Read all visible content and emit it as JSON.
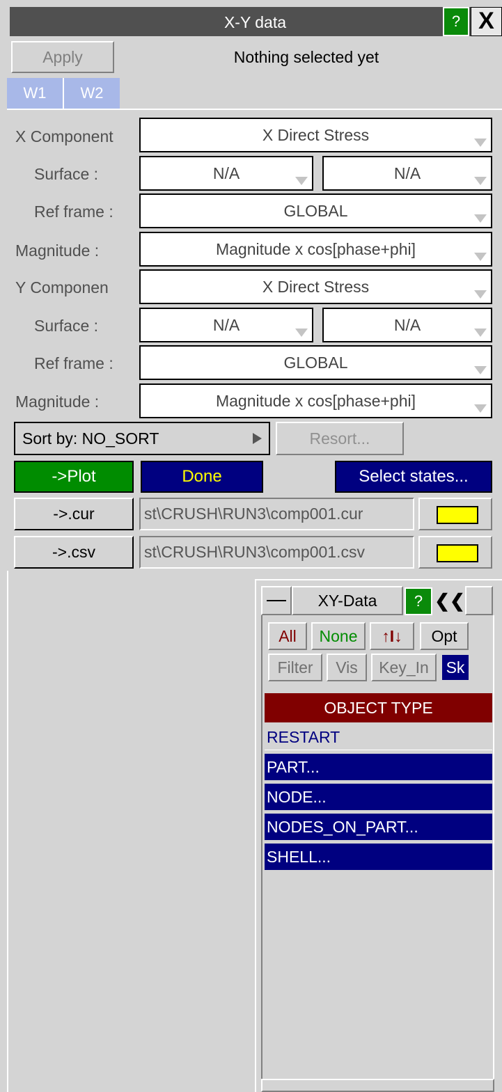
{
  "window": {
    "title": "X-Y data",
    "help": "?",
    "close": "X"
  },
  "toolbar": {
    "apply_label": "Apply",
    "status": "Nothing selected yet"
  },
  "tabs": [
    "W1",
    "W2"
  ],
  "x_component": {
    "label": "X Component",
    "value": "X Direct Stress",
    "surface_label": "Surface :",
    "surface_1": "N/A",
    "surface_2": "N/A",
    "ref_frame_label": "Ref frame :",
    "ref_frame": "GLOBAL",
    "magnitude_label": "Magnitude :",
    "magnitude": "Magnitude x cos[phase+phi]"
  },
  "y_component": {
    "label": "Y Componen",
    "value": "X Direct Stress",
    "surface_label": "Surface :",
    "surface_1": "N/A",
    "surface_2": "N/A",
    "ref_frame_label": "Ref frame :",
    "ref_frame": "GLOBAL",
    "magnitude_label": "Magnitude :",
    "magnitude": "Magnitude x cos[phase+phi]"
  },
  "sort": {
    "label": "Sort by: NO_SORT",
    "resort_label": "Resort..."
  },
  "actions": {
    "plot_label": "->Plot",
    "done_label": "Done",
    "select_states_label": "Select states..."
  },
  "files": {
    "cur_button": "->.cur",
    "cur_path": "st\\CRUSH\\RUN3\\comp001.cur",
    "csv_button": "->.csv",
    "csv_path": "st\\CRUSH\\RUN3\\comp001.csv"
  },
  "xy_panel": {
    "title": "XY-Data",
    "help": "?",
    "collapse": "❮❮",
    "buttons": {
      "all": "All",
      "none": "None",
      "sort": "↑I↓",
      "opt": "Opt",
      "filter": "Filter",
      "vis": "Vis",
      "key_in": "Key_In",
      "sk": "Sk"
    },
    "header": "OBJECT TYPE",
    "items": [
      "RESTART",
      "PART...",
      "NODE...",
      "NODES_ON_PART...",
      "SHELL..."
    ]
  },
  "colors": {
    "title_bar": "#505050",
    "help_green": "#0a8a0a",
    "plot_green": "#008c00",
    "navy": "#000080",
    "header_maroon": "#800000",
    "folder_yellow": "#ffff00",
    "tab_blue": "#a8b8e8"
  }
}
